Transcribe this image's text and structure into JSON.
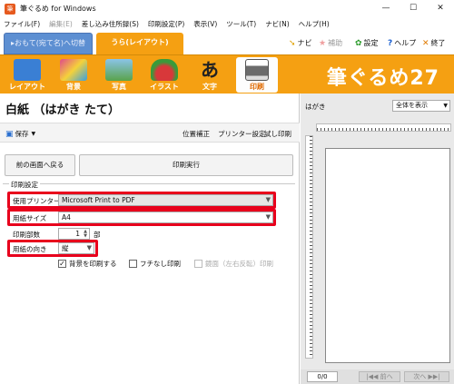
{
  "window": {
    "title": "筆ぐるめ for Windows",
    "app_icon_glyph": "筆",
    "min": "—",
    "max": "☐",
    "close": "✕"
  },
  "menu": [
    {
      "label": "ファイル(F)",
      "disabled": false
    },
    {
      "label": "編集(E)",
      "disabled": true
    },
    {
      "label": "差し込み住所録(S)",
      "disabled": false
    },
    {
      "label": "印刷設定(P)",
      "disabled": false
    },
    {
      "label": "表示(V)",
      "disabled": false
    },
    {
      "label": "ツール(T)",
      "disabled": false
    },
    {
      "label": "ナビ(N)",
      "disabled": false
    },
    {
      "label": "ヘルプ(H)",
      "disabled": false
    }
  ],
  "tabs": {
    "front": "▸おもて(宛て名)へ切替",
    "back": "うら(レイアウト)"
  },
  "tools": {
    "navi": "ナビ",
    "navi_icon": "cursor-icon",
    "assist": "補助",
    "assist_icon": "star-icon",
    "settings": "設定",
    "settings_icon": "gear-icon",
    "help": "ヘルプ",
    "help_icon": "question-icon",
    "exit": "終了",
    "exit_icon": "exit-icon"
  },
  "ribbon": {
    "items": [
      {
        "label": "レイアウト",
        "icon": "layout-icon",
        "color": "#3a7fd4"
      },
      {
        "label": "背景",
        "icon": "background-icon",
        "color": "#e04a8a"
      },
      {
        "label": "写真",
        "icon": "photo-icon",
        "color": "#5aa34a"
      },
      {
        "label": "イラスト",
        "icon": "illustration-icon",
        "color": "#d8383a"
      },
      {
        "label": "文字",
        "icon": "text-icon",
        "color": "#222222"
      },
      {
        "label": "印刷",
        "icon": "printer-icon",
        "color": "#6b6b6b"
      }
    ],
    "brand": "筆ぐるめ27"
  },
  "left": {
    "title": "白紙 （はがき たて）",
    "save_label": "保存",
    "position_fix": "位置補正",
    "printer_settings": "プリンター設定",
    "test_print": "試し印刷",
    "back_button": "前の画面へ戻る",
    "print_button": "印刷実行"
  },
  "print_settings": {
    "legend": "印刷設定",
    "printer_label": "使用プリンター",
    "printer_value": "Microsoft Print to PDF",
    "paper_size_label": "用紙サイズ",
    "paper_size_value": "A4",
    "copies_label": "印刷部数",
    "copies_value": "1",
    "copies_unit": "部",
    "orientation_label": "用紙の向き",
    "orientation_value": "縦",
    "print_background": "背景を印刷する",
    "borderless": "フチなし印刷",
    "mirror": "鏡面（左右反転）印刷"
  },
  "preview": {
    "label": "はがき",
    "view_select": "全体を表示",
    "page_count": "0/0",
    "prev": "|◀◀ 前へ",
    "next": "次へ ▶▶|"
  },
  "colors": {
    "accent": "#f5a012",
    "highlight": "#e8001c",
    "tab_front": "#5d8fd2"
  }
}
